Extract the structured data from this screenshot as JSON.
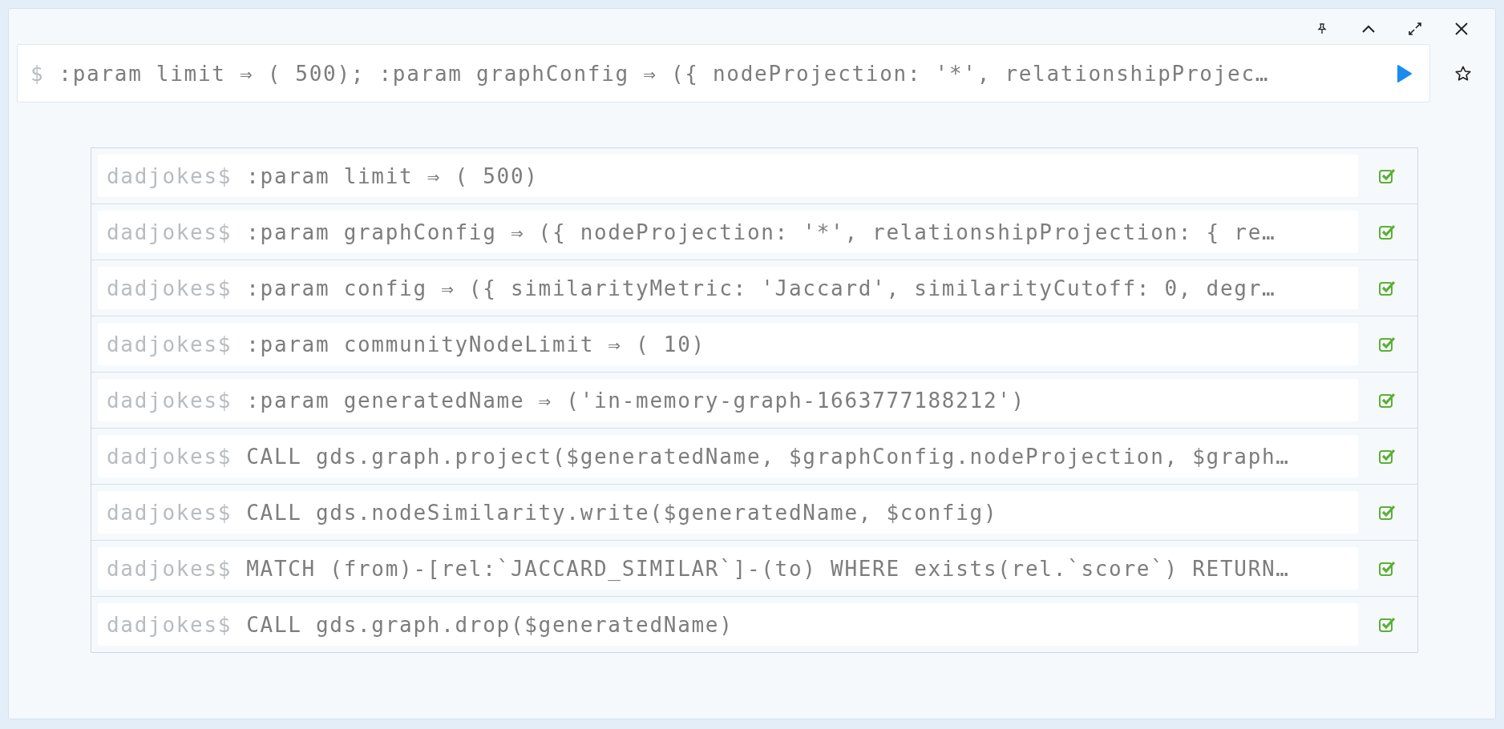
{
  "editor": {
    "prompt": "$",
    "query": ":param limit ⇒ ( 500); :param graphConfig ⇒ ({ nodeProjection: '*', relationshipProjec…"
  },
  "history": [
    {
      "prompt": "dadjokes$",
      "command": ":param limit ⇒ ( 500)",
      "success": true
    },
    {
      "prompt": "dadjokes$",
      "command": ":param graphConfig ⇒ ({ nodeProjection: '*', relationshipProjection: { re…",
      "success": true
    },
    {
      "prompt": "dadjokes$",
      "command": ":param config ⇒ ({ similarityMetric: 'Jaccard', similarityCutoff: 0, degr…",
      "success": true
    },
    {
      "prompt": "dadjokes$",
      "command": ":param communityNodeLimit ⇒ ( 10)",
      "success": true
    },
    {
      "prompt": "dadjokes$",
      "command": ":param generatedName ⇒ ('in-memory-graph-1663777188212')",
      "success": true
    },
    {
      "prompt": "dadjokes$",
      "command": "CALL gds.graph.project($generatedName, $graphConfig.nodeProjection, $graph…",
      "success": true
    },
    {
      "prompt": "dadjokes$",
      "command": "CALL gds.nodeSimilarity.write($generatedName, $config)",
      "success": true
    },
    {
      "prompt": "dadjokes$",
      "command": "MATCH (from)-[rel:`JACCARD_SIMILAR`]-(to) WHERE exists(rel.`score`) RETURN…",
      "success": true
    },
    {
      "prompt": "dadjokes$",
      "command": "CALL gds.graph.drop($generatedName)",
      "success": true
    }
  ]
}
